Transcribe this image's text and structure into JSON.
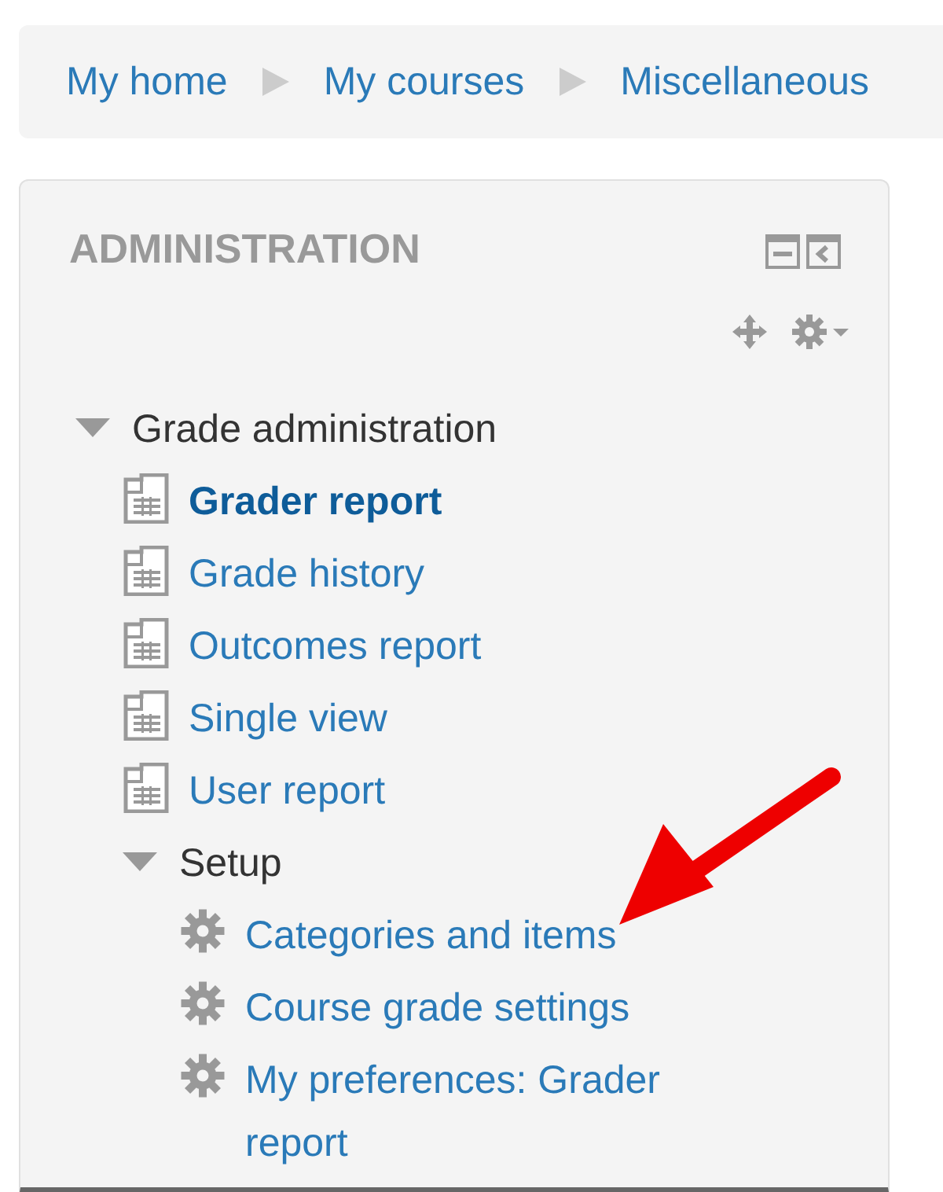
{
  "breadcrumb": [
    {
      "label": "My home"
    },
    {
      "label": "My courses"
    },
    {
      "label": "Miscellaneous"
    }
  ],
  "block": {
    "title": "ADMINISTRATION",
    "tree": [
      {
        "label": "Grade administration",
        "kind": "folder",
        "expanded": true,
        "children": [
          {
            "label": "Grader report",
            "kind": "report",
            "selected": true
          },
          {
            "label": "Grade history",
            "kind": "report",
            "selected": false
          },
          {
            "label": "Outcomes report",
            "kind": "report",
            "selected": false
          },
          {
            "label": "Single view",
            "kind": "report",
            "selected": false
          },
          {
            "label": "User report",
            "kind": "report",
            "selected": false
          },
          {
            "label": "Setup",
            "kind": "folder",
            "expanded": true,
            "children": [
              {
                "label": "Categories and items",
                "kind": "setting",
                "selected": false
              },
              {
                "label": "Course grade settings",
                "kind": "setting",
                "selected": false
              },
              {
                "label": "My preferences: Grader report",
                "kind": "setting",
                "selected": false
              }
            ]
          }
        ]
      }
    ]
  },
  "annotations": [
    {
      "kind": "arrow"
    }
  ]
}
